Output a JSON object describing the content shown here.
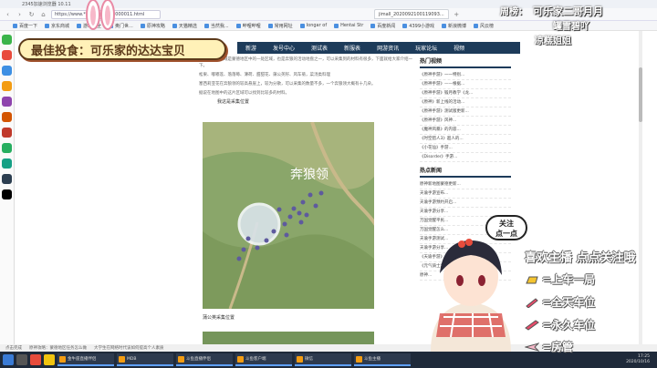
{
  "browser": {
    "title": "2345加速浏览器 10.11",
    "url": "https://www.******.cn/***8000011.html",
    "tabs": [
      "jimall_2020092100119093..."
    ]
  },
  "bookmarks": [
    "百度一下",
    "京东商城",
    "游戏大全",
    "奥门世...",
    "原神攻略",
    "天猫精选",
    "当然我...",
    "哔哩哔哩",
    "常用网址",
    "Iongar of",
    "Hentai Str",
    "百度新闻",
    "4399小游戏",
    "新浪微博",
    "风云榜"
  ],
  "site_nav": [
    "新游",
    "发号中心",
    "测试表",
    "新服表",
    "网游资讯",
    "玩家论坛",
    "视频"
  ],
  "article": {
    "paragraphs": [
      "奔狼领这个区域是蒙德地区中的一处区域，也是奔狼的活动地盘之一，可以采集到的材料有很多，下面就给大家介绍一下。",
      "松果、嘟嘟莲、落落莓、薄荷、甜甜花、蒲公英籽、风车菊，菜汤类料理",
      "塞西莉亚花在奔狼领的较高悬崖上，较为分散，可以采集的数量不多，一个奔狼领大概有十几朵。",
      "据说在地图中的这片区域可以找到比较多的材料。"
    ],
    "captions": [
      "我这是采集位置",
      "蒲公英采集位置"
    ],
    "map_label": "奔狼领"
  },
  "sidebar": {
    "hot_video_title": "热门视频",
    "hot_videos": [
      "《原神手游》一一特别...",
      "《原神手游》——根据...",
      "《原神手游》锻月教学《龙...",
      "《原神》新上线的活动...",
      "《原神手游》测试版更新...",
      "《原神手游》风神...",
      "《魔神风暴》的内容...",
      "《时空猎人3》超人的...",
      "《小花仙》手游...",
      "《Disorder》手游..."
    ],
    "hot_news_title": "热点新闻",
    "hot_news": [
      "原神新地图蒙德更新...",
      "天谕手游宣布...",
      "天谕手游预约开启...",
      "天谕手游分享...",
      "万国觉醒平民...",
      "万国觉醒怎么...",
      "天谕手游测试...",
      "天谕手游分享...",
      "《天谕手游》...",
      "《元气骑士》...",
      "原神..."
    ]
  },
  "status_bar": [
    "点击完成",
    "原神攻略：蒙德地区任务怎么做",
    "大学生在网络时代该如何提高个人素质"
  ],
  "taskbar": {
    "windows": [
      "金牛座直播伴侣",
      "MDB",
      "斗鱼直播伴侣",
      "斗鱼客户端",
      "微信",
      "斗鱼主播"
    ],
    "time": "17:25",
    "date": "2020/10/16"
  },
  "overlay": {
    "banner": "最佳投食：可乐家的达达宝贝",
    "top_right_label": "周榜：",
    "top_right_lines": [
      "可乐家二哥月月",
      "罐雪碧吖",
      "凉糕姐姐"
    ],
    "bubble": [
      "关注",
      "点一点"
    ],
    "cta": "喜欢主播 点点关注哦",
    "tiers": [
      "=上车一局",
      "=全天车位",
      "=永久车位",
      "=房管"
    ]
  },
  "colors": {
    "nav_bg": "#1d3b5a",
    "banner_bg": "#fff1b8",
    "banner_text": "#5c3a1a",
    "taskbar_bg": "#1f2a3a"
  }
}
